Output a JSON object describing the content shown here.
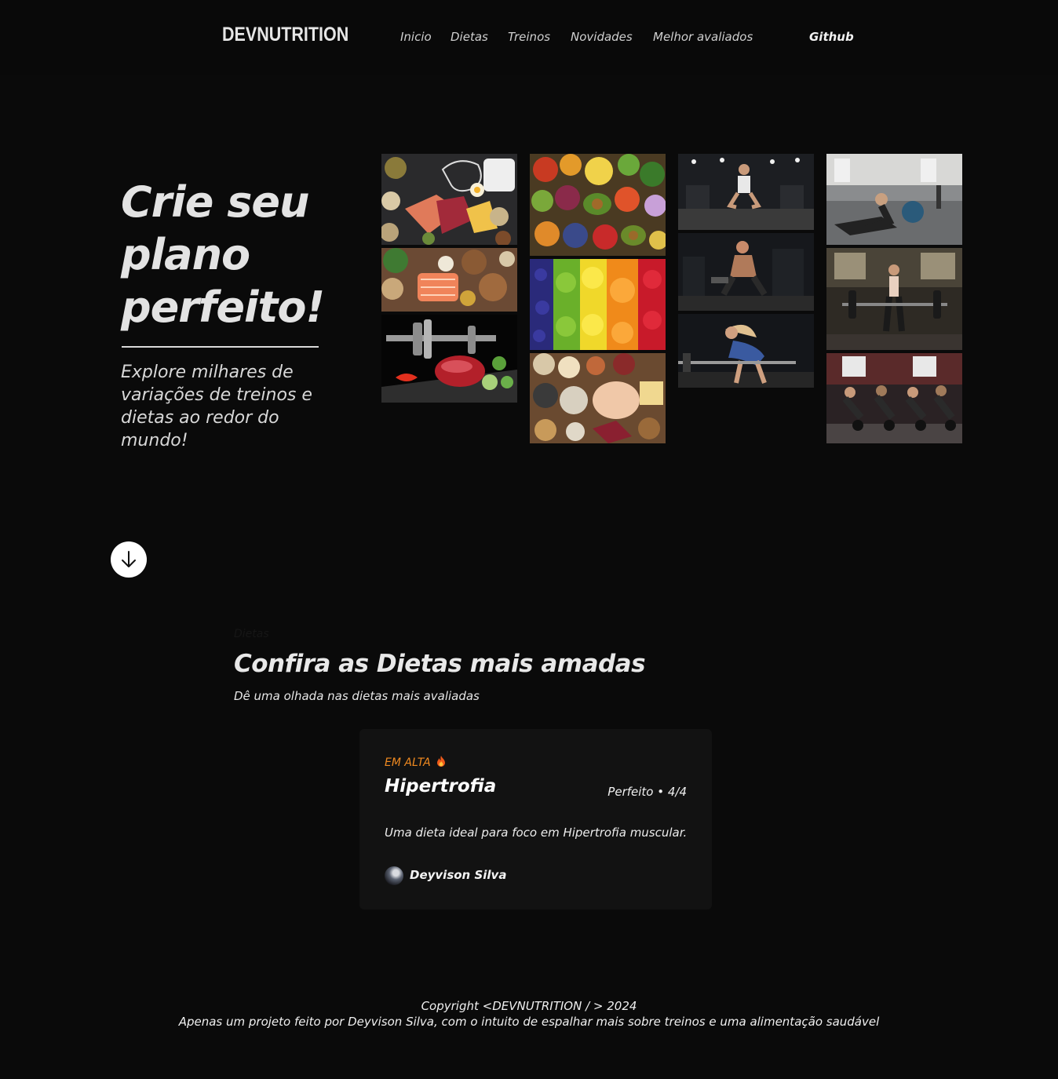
{
  "brand": {
    "logo": "DEVNUTRITION"
  },
  "nav": {
    "items": [
      "Inicio",
      "Dietas",
      "Treinos",
      "Novidades",
      "Melhor avaliados"
    ],
    "github": "Github"
  },
  "hero": {
    "title": "Crie seu plano perfeito!",
    "subtitle": "Explore milhares de variações de treinos e dietas ao redor do mundo!",
    "scroll_icon": "arrow-down-icon"
  },
  "gallery": {
    "images": [
      "healthy-foods-chalkboard-photo",
      "salmon-nuts-vegetables-photo",
      "dumbbell-meat-vegetables-photo",
      "assorted-fruits-vegetables-photo",
      "rainbow-fruits-photo",
      "grains-eggs-chicken-photo",
      "woman-squat-gym-photo",
      "man-dumbbell-gym-photo",
      "woman-barbell-row-photo",
      "woman-medicine-ball-situp-photo",
      "woman-deadlift-photo",
      "group-kettlebell-pushup-photo"
    ]
  },
  "section": {
    "kicker": "Dietas",
    "title": "Confira as Dietas mais amadas",
    "subtitle": "Dê uma olhada nas dietas mais avaliadas"
  },
  "card": {
    "badge": "EM ALTA",
    "badge_icon": "fire-icon",
    "badge_color": "#f08a20",
    "name": "Hipertrofia",
    "rating": "Perfeito • 4/4",
    "description": "Uma dieta ideal para foco em Hipertrofia muscular.",
    "author": "Deyvison Silva"
  },
  "footer": {
    "copyright": "Copyright <DEVNUTRITION / > 2024",
    "note": "Apenas um projeto feito por Deyvison Silva, com o intuito de espalhar mais sobre treinos e uma alimentação saudável"
  }
}
